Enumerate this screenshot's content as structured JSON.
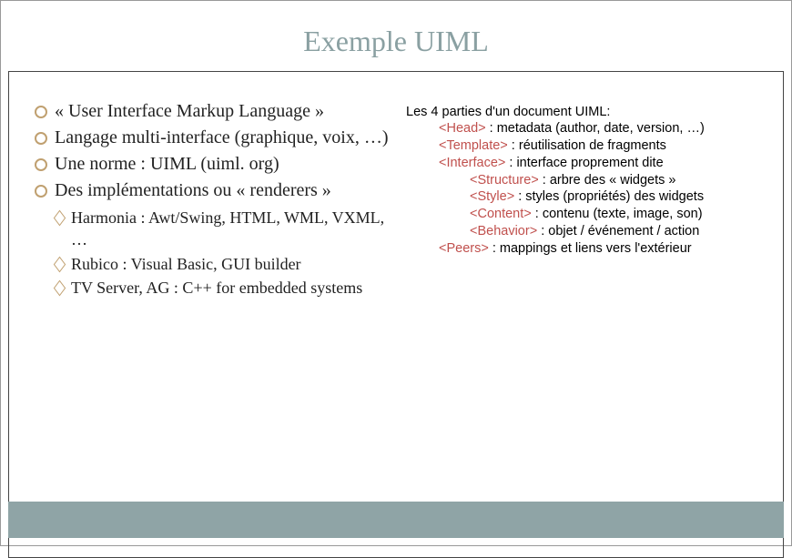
{
  "title": "Exemple UIML",
  "left": {
    "b1": "« User Interface Markup Language »",
    "b2": "Langage multi-interface (graphique, voix, …)",
    "b3": "Une norme : UIML (uiml. org)",
    "b4": "Des implémentations ou « renderers »",
    "s1": "Harmonia : Awt/Swing, HTML, WML, VXML, …",
    "s2": "Rubico : Visual Basic, GUI builder",
    "s3": "TV Server, AG : C++ for embedded systems"
  },
  "right": {
    "head": "Les 4 parties d'un document UIML:",
    "l1_tag": "<Head>",
    "l1_txt": " : metadata (author, date, version, …)",
    "l2_tag": "<Template>",
    "l2_txt": " : réutilisation de fragments",
    "l3_tag": "<Interface>",
    "l3_txt": " : interface proprement dite",
    "l31_tag": "<Structure>",
    "l31_txt": " : arbre des « widgets »",
    "l32_tag": "<Style>",
    "l32_txt": " : styles (propriétés) des widgets",
    "l33_tag": "<Content>",
    "l33_txt": " : contenu (texte, image, son)",
    "l34_tag": "<Behavior>",
    "l34_txt": " : objet / événement / action",
    "l4_tag": "<Peers>",
    "l4_txt": " : mappings et liens vers l'extérieur"
  }
}
